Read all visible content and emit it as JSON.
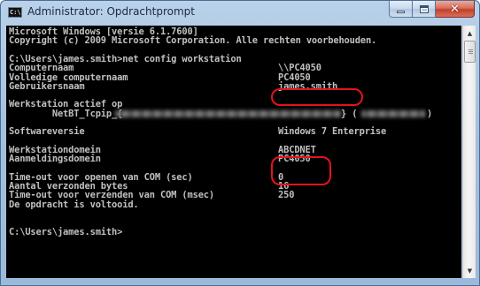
{
  "window": {
    "title": "Administrator: Opdrachtprompt",
    "app_icon_text": "C:\\"
  },
  "console": {
    "lines": [
      "Microsoft Windows [versie 6.1.7600]",
      "Copyright (c) 2009 Microsoft Corporation. Alle rechten voorbehouden.",
      "",
      "C:\\Users\\james.smith>net config workstation",
      "Computernaam",
      "Volledige computernaam",
      "Gebruikersnaam",
      "",
      "Werkstation actief op",
      "        NetBT_Tcpip_{",
      "",
      "Softwareversie",
      "",
      "Werkstationdomein",
      "Aanmeldingsdomein",
      "",
      "Time-out voor openen van COM (sec)",
      "Aantal verzonden bytes",
      "Time-out voor verzenden van COM (msec)",
      "De opdracht is voltooid.",
      "",
      "",
      "C:\\Users\\james.smith>"
    ],
    "values": {
      "computernaam": "\\\\PC4050",
      "volledige_computernaam": "PC4050",
      "gebruikersnaam": "james.smith",
      "netbt_mid": "} (",
      "netbt_end": ")",
      "softwareversie": "Windows 7 Enterprise",
      "werkstationdomein": "ABCDNET",
      "aanmeldingsdomein": "PC4050",
      "com_open": "0",
      "bytes": "16",
      "com_send": "250"
    }
  },
  "annotations": {
    "highlight_color": "#e3141a"
  }
}
